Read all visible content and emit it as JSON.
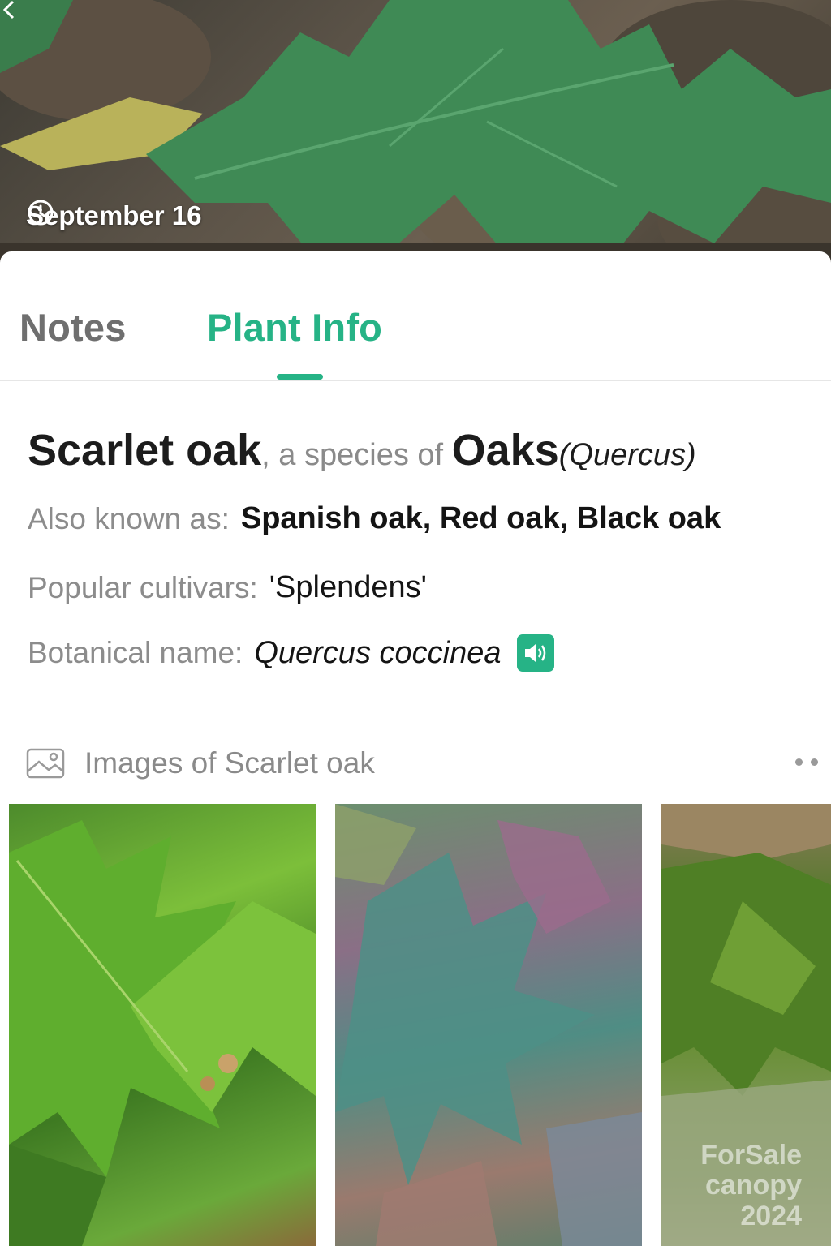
{
  "hero": {
    "date": "September 16",
    "icons": {
      "clock": "clock-icon",
      "back": "chevron-left-icon"
    }
  },
  "tabs": [
    {
      "label": "Notes",
      "active": false
    },
    {
      "label": "Plant Info",
      "active": true
    }
  ],
  "species": {
    "common_name": "Scarlet oak",
    "connector": ", a species of ",
    "genus_common": "Oaks",
    "genus_latin": "(Quercus)"
  },
  "details": {
    "aka_label": "Also known as:",
    "aka_value": "Spanish oak, Red oak, Black oak",
    "cultivars_label": "Popular cultivars:",
    "cultivars_value": "'Splendens'",
    "botanical_label": "Botanical name:",
    "botanical_value": "Quercus coccinea"
  },
  "images": {
    "header": "Images of Scarlet oak",
    "watermark_line1": "ForSale",
    "watermark_line2": "canopy 2024"
  },
  "colors": {
    "accent": "#26b386",
    "label_gray": "#8c8c8c",
    "text_dark": "#141414"
  }
}
